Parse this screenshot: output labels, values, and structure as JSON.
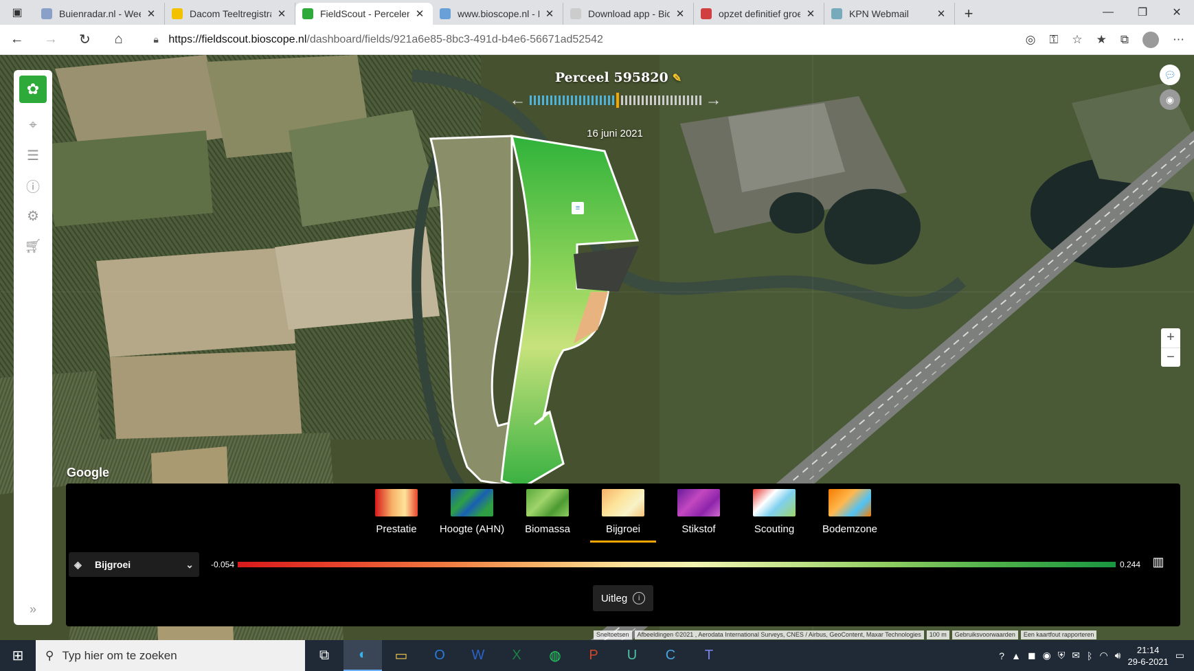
{
  "browser": {
    "tabs": [
      {
        "title": "Buienradar.nl - Weersv",
        "favicon_color": "#8aa0c8",
        "active": false
      },
      {
        "title": "Dacom Teeltregistratie",
        "favicon_color": "#f2c200",
        "active": false
      },
      {
        "title": "FieldScout - Percelen",
        "favicon_color": "#2eaa3a",
        "active": true
      },
      {
        "title": "www.bioscope.nl - Bin",
        "favicon_color": "#6aa0d8",
        "active": false
      },
      {
        "title": "Download app - BioSc",
        "favicon_color": "#cccccc",
        "active": false
      },
      {
        "title": "opzet definitief groei",
        "favicon_color": "#d04040",
        "active": false
      },
      {
        "title": "KPN Webmail",
        "favicon_color": "#7ab",
        "active": false
      }
    ],
    "url_host": "https://fieldscout.bioscope.nl",
    "url_path": "/dashboard/fields/921a6e85-8bc3-491d-b4e6-56671ad52542"
  },
  "field": {
    "title": "Perceel 595820",
    "date": "16 juni 2021"
  },
  "map": {
    "google_logo": "Google",
    "attribution": [
      "Sneltoetsen",
      "Afbeeldingen ©2021 , Aerodata International Surveys, CNES / Airbus, GeoContent, Maxar Technologies",
      "100 m",
      "Gebruiksvoorwaarden",
      "Een kaartfout rapporteren"
    ]
  },
  "panel": {
    "layers": [
      {
        "label": "Prestatie",
        "gradient": "linear-gradient(90deg,#d7191c,#f7b267 40%,#fde39a 70%,#e8452c)",
        "active": false
      },
      {
        "label": "Hoogte (AHN)",
        "gradient": "linear-gradient(135deg,#1a5fb4,#2ea043 35%,#1a5fb4 55%,#2ea043 80%)",
        "active": false
      },
      {
        "label": "Biomassa",
        "gradient": "linear-gradient(135deg,#5aa83c,#9fd46a 40%,#4c9a32 70%,#8fcd62)",
        "active": false
      },
      {
        "label": "Bijgroei",
        "gradient": "linear-gradient(135deg,#f7b267,#fde39a 40%,#f7f2c8 70%,#f5c37a)",
        "active": true
      },
      {
        "label": "Stikstof",
        "gradient": "linear-gradient(135deg,#6a1b9a,#c248c0 40%,#8e24aa 70%,#d06ad0)",
        "active": false
      },
      {
        "label": "Scouting",
        "gradient": "linear-gradient(135deg,#e53935,#ffffff 35%,#7fd0f0 60%,#9fd46a)",
        "active": false
      },
      {
        "label": "Bodemzone",
        "gradient": "linear-gradient(135deg,#f57c00,#ffb74d 40%,#4fc3f7 70%,#f57c00)",
        "active": false
      }
    ],
    "selected_layer": "Bijgroei",
    "legend_min": "-0.054",
    "legend_max": "0.244",
    "uitleg_label": "Uitleg"
  },
  "taskbar": {
    "search_placeholder": "Typ hier om te zoeken",
    "time": "21:14",
    "date": "29-6-2021"
  }
}
